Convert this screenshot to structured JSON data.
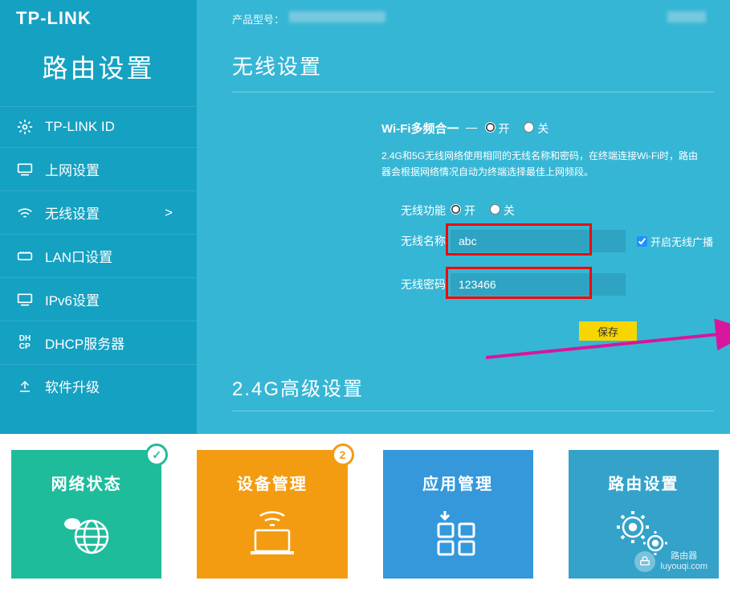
{
  "brand": "TP-LINK",
  "page_title": "路由设置",
  "header": {
    "model_label": "产品型号："
  },
  "nav": [
    {
      "label": "TP-LINK ID",
      "icon": "gear"
    },
    {
      "label": "上网设置",
      "icon": "monitor"
    },
    {
      "label": "无线设置",
      "icon": "wifi",
      "active": true,
      "arrow": ">"
    },
    {
      "label": "LAN口设置",
      "icon": "ethernet"
    },
    {
      "label": "IPv6设置",
      "icon": "monitor"
    },
    {
      "label": "DHCP服务器",
      "icon": "dhcp"
    },
    {
      "label": "软件升级",
      "icon": "upload"
    }
  ],
  "section1": {
    "title": "无线设置",
    "multiband_label": "Wi-Fi多频合一",
    "radio_on": "开",
    "radio_off": "关",
    "hint": "2.4G和5G无线网络使用相同的无线名称和密码，在终端连接Wi-Fi时，路由器会根据网络情况自动为终端选择最佳上网频段。",
    "func_label": "无线功能",
    "ssid_label": "无线名称",
    "ssid_value": "abc",
    "broadcast_label": "开启无线广播",
    "pwd_label": "无线密码",
    "pwd_value": "123466",
    "save_label": "保存"
  },
  "section2": {
    "title": "2.4G高级设置"
  },
  "tiles": {
    "network": {
      "title": "网络状态",
      "badge": "✓"
    },
    "device": {
      "title": "设备管理",
      "badge": "2"
    },
    "app": {
      "title": "应用管理"
    },
    "router": {
      "title": "路由设置"
    }
  },
  "watermark": {
    "name": "路由器",
    "domain": "luyouqi.com"
  },
  "colors": {
    "sidebar": "#15a1c2",
    "content": "#36b6d5",
    "save": "#f7d600",
    "annotation": "#f00"
  }
}
